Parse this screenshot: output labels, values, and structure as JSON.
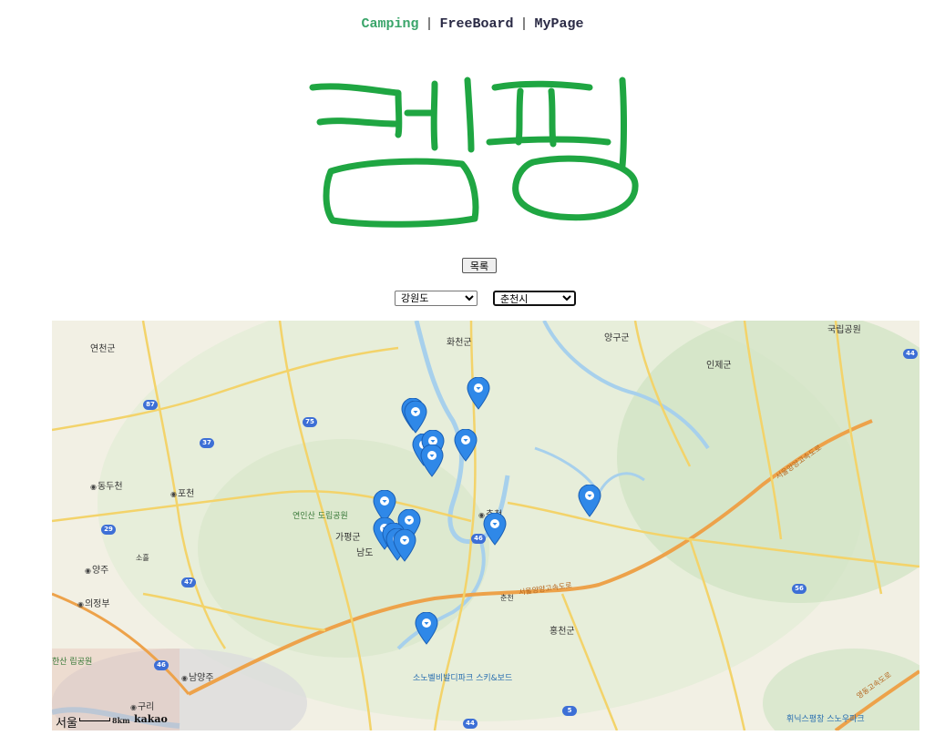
{
  "nav": {
    "items": [
      "Camping",
      "FreeBoard",
      "MyPage"
    ],
    "separator": "|"
  },
  "logo": {
    "text": "캠핑",
    "color": "#1fa642"
  },
  "list_button": {
    "label": "목록"
  },
  "filters": {
    "province": {
      "selected": "강원도"
    },
    "city": {
      "selected": "춘천시"
    }
  },
  "map": {
    "labels": {
      "yeoncheon": "연천군",
      "hwacheon": "화천군",
      "yanggu": "양구군",
      "inje": "인제군",
      "national_park": "국립공원",
      "dongducheon": "동두천",
      "pocheon": "포천",
      "yeoninsan_park": "연인산 도립공원",
      "gapyeong": "가평군",
      "namdo": "남도",
      "chuncheon_city": "춘천",
      "chuncheon_lower": "춘천",
      "soheul": "소흘",
      "yangju": "양주",
      "uijeongbu": "의정부",
      "hongcheon": "홍천군",
      "bukhan_park": "한산 립공원",
      "namyangju": "남양주",
      "guri": "구리",
      "vivaldi": "소노벨비발디파크 스키&보드",
      "phoenix": "휘닉스평창 스노우파크",
      "expressway_1": "서울양양고속도로",
      "expressway_2": "서울양양고속도로",
      "expressway_3": "영동고속도로"
    },
    "route_shields": [
      "44",
      "87",
      "75",
      "37",
      "29",
      "47",
      "46",
      "56",
      "46",
      "5",
      "44"
    ],
    "scale_text": "8km",
    "attribution": "kakao",
    "seoul_label": "서울",
    "marker_count": 16
  }
}
